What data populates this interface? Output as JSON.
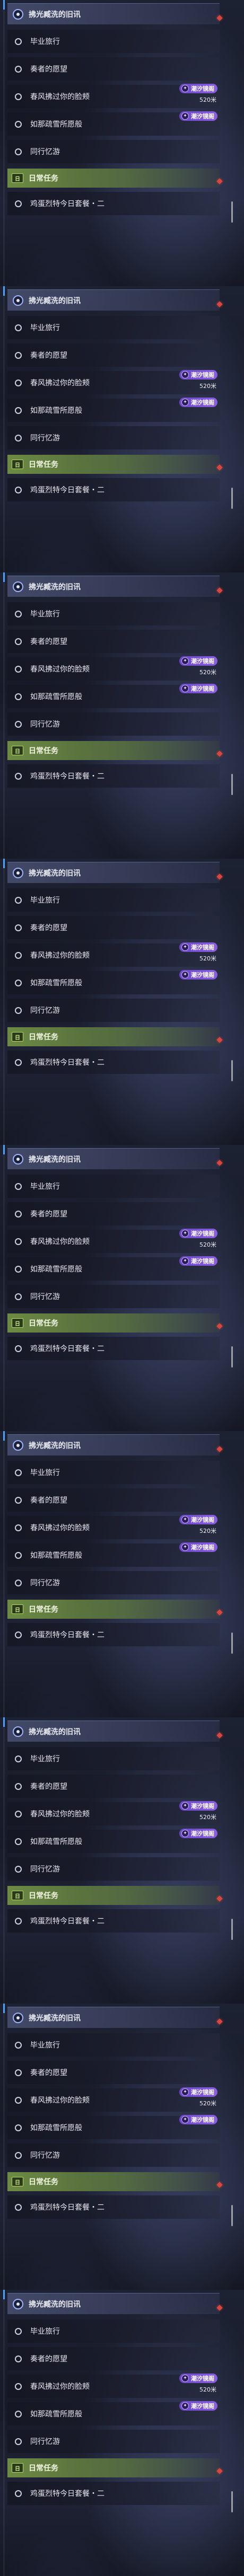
{
  "panel_count": 9,
  "colors": {
    "header_accent": "#9fb4ff",
    "daily_green": "#769646",
    "badge_purple": "#7a52d6",
    "marker_red": "#d9453f"
  },
  "quest_panel": {
    "header_icon": "target-icon",
    "header_title": "拂光臧洗的旧讯",
    "items": [
      {
        "label": "毕业旅行",
        "icon": "circle-icon"
      },
      {
        "label": "奏者的愿望",
        "icon": "circle-icon"
      },
      {
        "label": "春风拂过你的脸颊",
        "icon": "circle-icon"
      },
      {
        "label": "如那疏雪所愿般",
        "icon": "circle-icon"
      },
      {
        "label": "同行忆游",
        "icon": "circle-icon"
      }
    ],
    "badge_1": {
      "icon": "compass-icon",
      "text": "潮汐镜阁",
      "distance": "520米"
    },
    "badge_2": {
      "icon": "compass-icon",
      "text": "潮汐镜阁"
    },
    "daily": {
      "icon_text": "日",
      "title": "日常任务",
      "item_label": "鸡蛋烈特今日套餐・二"
    }
  }
}
